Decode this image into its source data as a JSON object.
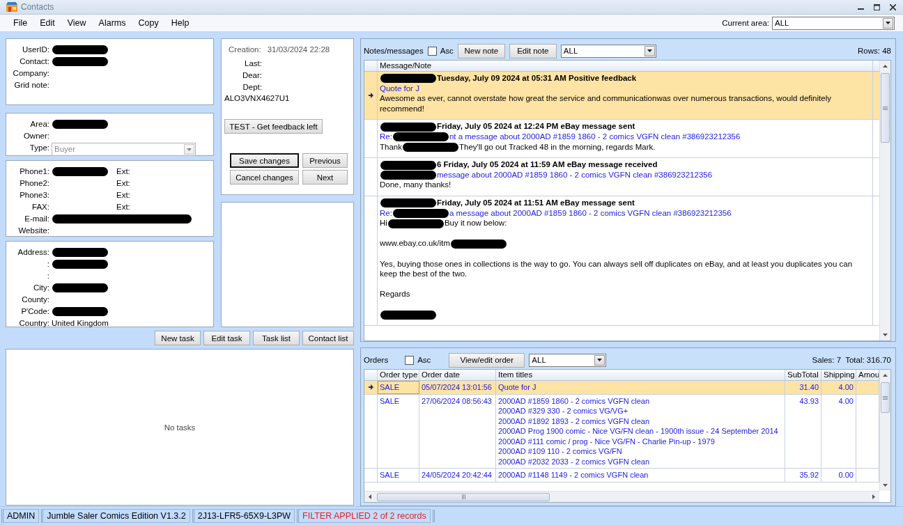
{
  "window": {
    "title": "Contacts"
  },
  "menu": [
    "File",
    "Edit",
    "View",
    "Alarms",
    "Copy",
    "Help"
  ],
  "current_area": {
    "label": "Current area:",
    "value": "ALL"
  },
  "contact": {
    "sections": [
      [
        {
          "label": "UserID:",
          "redacted": true
        },
        {
          "label": "Contact:",
          "redacted": true
        },
        {
          "label": "Company:"
        },
        {
          "label": "Grid note:"
        }
      ],
      [
        {
          "label": "Area:",
          "redacted": true
        },
        {
          "label": "Owner:"
        },
        {
          "label": "Type:",
          "kind": "dropdown",
          "value": "Buyer",
          "disabled": true
        }
      ],
      [
        {
          "label": "Phone1:",
          "redacted": true,
          "ext": "Ext:"
        },
        {
          "label": "Phone2:",
          "ext": "Ext:"
        },
        {
          "label": "Phone3:",
          "ext": "Ext:"
        },
        {
          "label": "FAX:",
          "ext": "Ext:"
        },
        {
          "label": "E-mail:",
          "redacted": true
        },
        {
          "label": "Website:"
        }
      ],
      [
        {
          "label": "Address:",
          "redacted": true
        },
        {
          "label": ":",
          "redacted": true
        },
        {
          "label": ":"
        },
        {
          "label": "City:",
          "redacted": true
        },
        {
          "label": "County:"
        },
        {
          "label": "P'Code:",
          "redacted": true
        },
        {
          "label": "Country:",
          "value": "United Kingdom"
        }
      ]
    ]
  },
  "details": {
    "creation_label": "Creation:",
    "creation": "31/03/2024 22:28",
    "fields": [
      "Last:",
      "Dear:",
      "Dept:"
    ],
    "code": "ALO3VNX4627U1",
    "test_button": "TEST - Get feedback left",
    "buttons": [
      {
        "label": "Save changes",
        "default": true
      },
      {
        "label": "Previous",
        "default": false
      },
      {
        "label": "Cancel changes",
        "default": false
      },
      {
        "label": "Next",
        "default": false
      }
    ]
  },
  "task_buttons": [
    "New task",
    "Edit task",
    "Task list",
    "Contact list"
  ],
  "tasks": {
    "empty_text": "No tasks"
  },
  "notes": {
    "title": "Notes/messages",
    "asc": {
      "label": "Asc",
      "checked": false
    },
    "buttons": [
      "New note",
      "Edit note"
    ],
    "filter": "ALL",
    "rows_count": "Rows: 48",
    "column": "Message/Note",
    "messages": [
      {
        "selected": true,
        "header": [
          {
            "kind": "redaction"
          },
          {
            "kind": "text",
            "text": "Tuesday, July 09 2024 at 05:31 AM Positive feedback"
          }
        ],
        "subject": [
          {
            "kind": "text",
            "text": "Quote for J"
          }
        ],
        "body": [
          [
            {
              "kind": "text",
              "text": "Awesome as ever, cannot overstate how great the service and communicationwas over numerous transactions, would definitely recommend!"
            }
          ]
        ]
      },
      {
        "selected": false,
        "header": [
          {
            "kind": "redaction"
          },
          {
            "kind": "text",
            "text": "Friday, July 05 2024 at 12:24 PM eBay message sent"
          }
        ],
        "subject": [
          {
            "kind": "text",
            "text": "Re:"
          },
          {
            "kind": "redaction"
          },
          {
            "kind": "text",
            "text": "nt a message about 2000AD #1859 1860 - 2 comics VGFN clean #386923212356"
          }
        ],
        "body": [
          [
            {
              "kind": "text",
              "text": "Thank"
            },
            {
              "kind": "redaction"
            },
            {
              "kind": "text",
              "text": "They'll go out Tracked 48 in the morning, regards Mark."
            }
          ]
        ]
      },
      {
        "selected": false,
        "header": [
          {
            "kind": "redaction"
          },
          {
            "kind": "text",
            "text": "6 Friday, July 05 2024 at 11:59 AM eBay message received"
          }
        ],
        "subject": [
          {
            "kind": "redaction"
          },
          {
            "kind": "text",
            "text": "message about 2000AD #1859 1860 - 2 comics VGFN clean #386923212356"
          }
        ],
        "body": [
          [
            {
              "kind": "text",
              "text": "Done, many thanks!"
            }
          ]
        ]
      },
      {
        "selected": false,
        "header": [
          {
            "kind": "redaction"
          },
          {
            "kind": "text",
            "text": "Friday, July 05 2024 at 11:51 AM eBay message sent"
          }
        ],
        "subject": [
          {
            "kind": "text",
            "text": "Re:"
          },
          {
            "kind": "redaction"
          },
          {
            "kind": "text",
            "text": "a message about 2000AD #1859 1860 - 2 comics VGFN clean #386923212356"
          }
        ],
        "body": [
          [
            {
              "kind": "text",
              "text": "Hi"
            },
            {
              "kind": "redaction"
            },
            {
              "kind": "text",
              "text": "Buy it now below:"
            }
          ],
          [
            {
              "kind": "text",
              "text": "www.ebay.co.uk/itm"
            },
            {
              "kind": "redaction"
            }
          ],
          [
            {
              "kind": "text",
              "text": "Yes, buying those ones in collections is the way to go. You can always sell off duplicates on eBay, and at least you duplicates you can keep the best of the two."
            }
          ],
          [
            {
              "kind": "text",
              "text": "Regards"
            }
          ],
          [
            {
              "kind": "redaction"
            }
          ]
        ]
      }
    ]
  },
  "orders": {
    "title": "Orders",
    "asc": {
      "label": "Asc",
      "checked": false
    },
    "button": "View/edit order",
    "filter": "ALL",
    "sales": "Sales: 7",
    "total": "Total: 316.70",
    "columns": [
      "Order type",
      "Order date",
      "Item titles",
      "SubTotal",
      "Shipping",
      "Amou"
    ],
    "rows": [
      {
        "selected": true,
        "type": "SALE",
        "date": "05/07/2024 13:01:56",
        "titles": [
          "Quote for J"
        ],
        "subtotal": "31.40",
        "shipping": "4.00"
      },
      {
        "selected": false,
        "type": "SALE",
        "date": "27/06/2024 08:56:43",
        "titles": [
          "2000AD #1859 1860 - 2 comics VGFN clean",
          "2000AD #329 330 - 2 comics VG/VG+",
          "2000AD #1892 1893 - 2 comics VGFN clean",
          "2000AD Prog 1900 comic - Nice VG/FN clean - 1900th issue - 24 September 2014",
          "2000AD #111 comic / prog - Nice VG/FN - Charlie Pin-up - 1979",
          "2000AD #109 110 - 2 comics VG/FN",
          "2000AD #2032 2033 - 2 comics VGFN clean"
        ],
        "subtotal": "43.93",
        "shipping": "4.00"
      },
      {
        "selected": false,
        "type": "SALE",
        "date": "24/05/2024 20:42:44",
        "titles": [
          "2000AD #1148 1149 - 2 comics VGFN clean"
        ],
        "subtotal": "35.92",
        "shipping": "0.00"
      }
    ]
  },
  "status_bar": [
    {
      "kind": "normal",
      "text": "ADMIN"
    },
    {
      "kind": "normal",
      "text": "Jumble Saler Comics Edition V1.3.2"
    },
    {
      "kind": "normal",
      "text": "2J13-LFR5-65X9-L3PW"
    },
    {
      "kind": "alert",
      "text": "FILTER APPLIED 2 of 2 records"
    }
  ]
}
